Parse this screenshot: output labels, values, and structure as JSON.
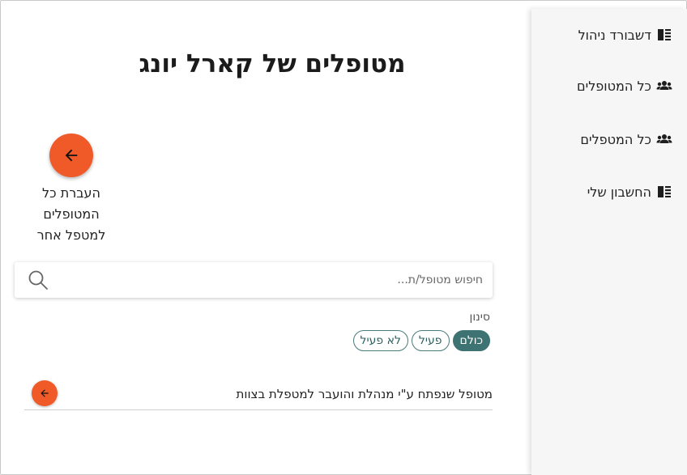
{
  "sidebar": {
    "items": [
      {
        "label": "דשבורד ניהול",
        "icon": "book-icon"
      },
      {
        "label": "כל המטופלים",
        "icon": "group-icon"
      },
      {
        "label": "כל המטפלים",
        "icon": "group-icon"
      },
      {
        "label": "החשבון שלי",
        "icon": "book-icon"
      }
    ]
  },
  "main": {
    "title": "מטופלים של קארל יונג",
    "transfer_all": {
      "line1": "העברת כל",
      "line2": "המטופלים",
      "line3": "למטפל אחר",
      "icon": "arrow-left-icon"
    },
    "search": {
      "placeholder": "חיפוש מטופל/ת...",
      "value": "",
      "icon": "search-icon"
    },
    "filter": {
      "label": "סינון",
      "options": [
        "כולם",
        "פעיל",
        "לא פעיל"
      ],
      "selected": "כולם"
    },
    "patients": [
      {
        "text": "מטופל שנפתח ע\"י מנהלת והועבר למטפלת בצוות",
        "icon": "arrow-left-icon"
      }
    ]
  },
  "colors": {
    "accent": "#f05a28",
    "teal": "#3e7373",
    "sidebar_bg": "#f6f6f6"
  }
}
